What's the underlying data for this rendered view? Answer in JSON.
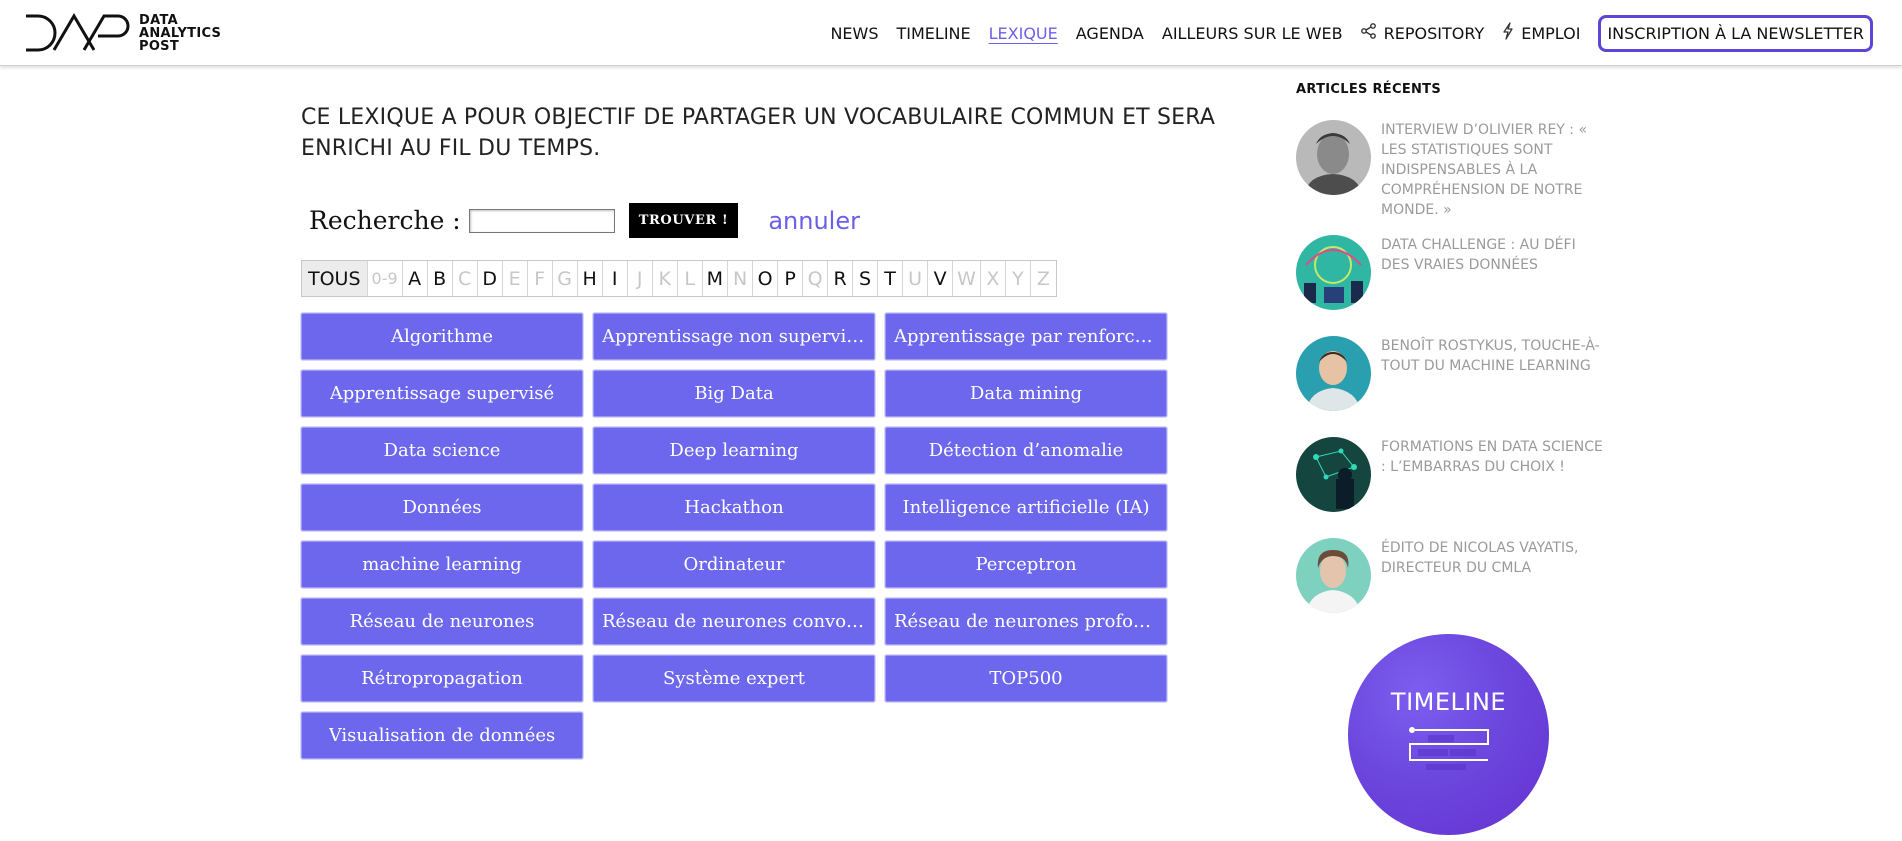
{
  "header": {
    "logo_lines": [
      "DATA",
      "ANALYTICS",
      "POST"
    ],
    "nav": [
      {
        "label": "NEWS",
        "icon": "",
        "active": false
      },
      {
        "label": "TIMELINE",
        "icon": "",
        "active": false
      },
      {
        "label": "LEXIQUE",
        "icon": "",
        "active": true
      },
      {
        "label": "AGENDA",
        "icon": "",
        "active": false
      },
      {
        "label": "AILLEURS SUR LE WEB",
        "icon": "",
        "active": false
      },
      {
        "label": "REPOSITORY",
        "icon": "share-icon",
        "active": false
      },
      {
        "label": "EMPLOI",
        "icon": "lightning-icon",
        "active": false
      }
    ],
    "cta_label": "INSCRIPTION À LA NEWSLETTER"
  },
  "main": {
    "intro": "CE LEXIQUE A POUR OBJECTIF DE PARTAGER UN VOCABULAIRE COMMUN ET SERA ENRICHI AU FIL DU TEMPS.",
    "search": {
      "label": "Recherche :",
      "value": "",
      "button": "TROUVER !",
      "cancel": "annuler"
    },
    "letters": [
      {
        "label": "TOUS",
        "enabled": true,
        "selected": true
      },
      {
        "label": "0-9",
        "enabled": false
      },
      {
        "label": "A",
        "enabled": true
      },
      {
        "label": "B",
        "enabled": true
      },
      {
        "label": "C",
        "enabled": false
      },
      {
        "label": "D",
        "enabled": true
      },
      {
        "label": "E",
        "enabled": false
      },
      {
        "label": "F",
        "enabled": false
      },
      {
        "label": "G",
        "enabled": false
      },
      {
        "label": "H",
        "enabled": true
      },
      {
        "label": "I",
        "enabled": true
      },
      {
        "label": "J",
        "enabled": false
      },
      {
        "label": "K",
        "enabled": false
      },
      {
        "label": "L",
        "enabled": false
      },
      {
        "label": "M",
        "enabled": true
      },
      {
        "label": "N",
        "enabled": false
      },
      {
        "label": "O",
        "enabled": true
      },
      {
        "label": "P",
        "enabled": true
      },
      {
        "label": "Q",
        "enabled": false
      },
      {
        "label": "R",
        "enabled": true
      },
      {
        "label": "S",
        "enabled": true
      },
      {
        "label": "T",
        "enabled": true
      },
      {
        "label": "U",
        "enabled": false
      },
      {
        "label": "V",
        "enabled": true
      },
      {
        "label": "W",
        "enabled": false
      },
      {
        "label": "X",
        "enabled": false
      },
      {
        "label": "Y",
        "enabled": false
      },
      {
        "label": "Z",
        "enabled": false
      }
    ],
    "terms": [
      "Algorithme",
      "Apprentissage non supervisé",
      "Apprentissage par renforceme...",
      "Apprentissage supervisé",
      "Big Data",
      "Data mining",
      "Data science",
      "Deep learning",
      "Détection d’anomalie",
      "Données",
      "Hackathon",
      "Intelligence artificielle (IA)",
      "machine learning",
      "Ordinateur",
      "Perceptron",
      "Réseau de neurones",
      "Réseau de neurones convolutifs",
      "Réseau de neurones profonds",
      "Rétropropagation",
      "Système expert",
      "TOP500",
      "Visualisation de données"
    ]
  },
  "sidebar": {
    "title": "ARTICLES RÉCENTS",
    "articles": [
      {
        "title": "INTERVIEW D’OLIVIER REY : « LES STATISTIQUES SONT INDISPENSABLES À LA COMPRÉHENSION DE NOTRE MONDE. »",
        "thumb": "portrait-grayscale"
      },
      {
        "title": "DATA CHALLENGE : AU DÉFI DES VRAIES DONNÉES",
        "thumb": "illustration-teal"
      },
      {
        "title": "BENOÎT ROSTYKUS, TOUCHE-À-TOUT DU MACHINE LEARNING",
        "thumb": "portrait-teal"
      },
      {
        "title": "FORMATIONS EN DATA SCIENCE : L’EMBARRAS DU CHOIX !",
        "thumb": "illustration-dark-teal"
      },
      {
        "title": "ÉDITO DE NICOLAS VAYATIS, DIRECTEUR DU CMLA",
        "thumb": "portrait-mint"
      }
    ],
    "timeline_label": "TIMELINE"
  },
  "colors": {
    "accent": "#6a5fe8",
    "term_bg": "#6d67ee",
    "cta_border": "#5b46d8",
    "timeline_bg": "#6c47de"
  }
}
